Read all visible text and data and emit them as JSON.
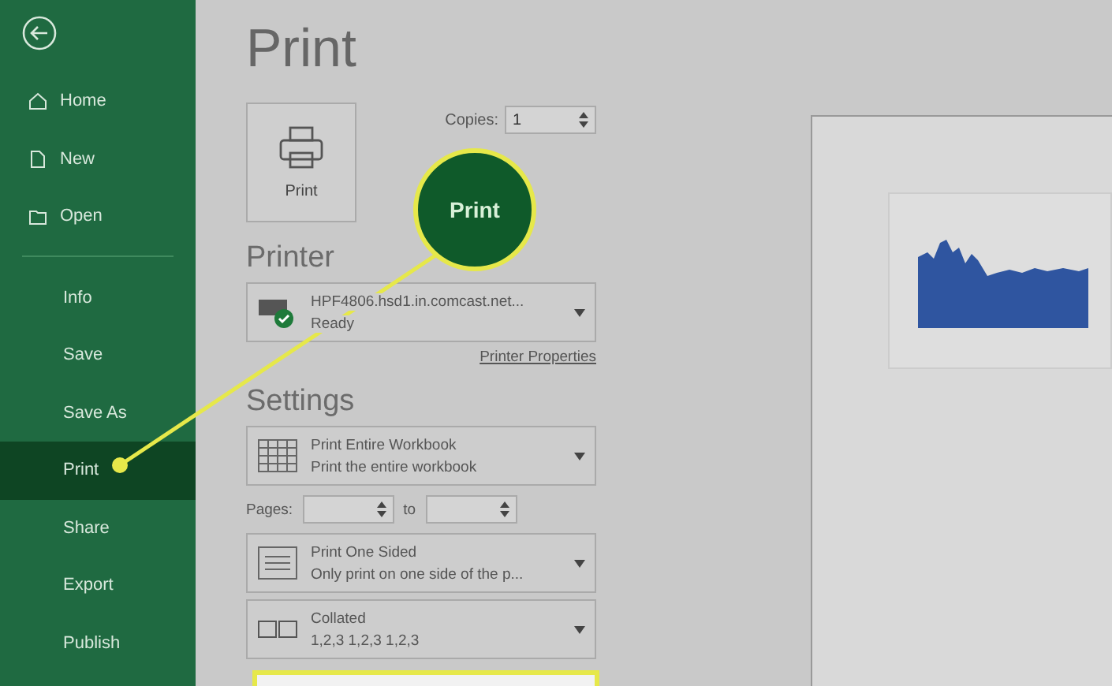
{
  "sidebar": {
    "items": [
      {
        "label": "Home",
        "kind": "icon",
        "selected": false
      },
      {
        "label": "New",
        "kind": "icon",
        "selected": false
      },
      {
        "label": "Open",
        "kind": "icon",
        "selected": false
      },
      {
        "label": "Info",
        "kind": "plain",
        "selected": false
      },
      {
        "label": "Save",
        "kind": "plain",
        "selected": false
      },
      {
        "label": "Save As",
        "kind": "plain",
        "selected": false
      },
      {
        "label": "Print",
        "kind": "plain",
        "selected": true
      },
      {
        "label": "Share",
        "kind": "plain",
        "selected": false
      },
      {
        "label": "Export",
        "kind": "plain",
        "selected": false
      },
      {
        "label": "Publish",
        "kind": "plain",
        "selected": false
      }
    ]
  },
  "title": "Print",
  "print_button": {
    "label": "Print"
  },
  "copies": {
    "label": "Copies:",
    "value": "1"
  },
  "callout": {
    "label": "Print"
  },
  "printer": {
    "heading": "Printer",
    "name": "HPF4806.hsd1.in.comcast.net...",
    "status": "Ready",
    "properties_link": "Printer Properties"
  },
  "settings": {
    "heading": "Settings",
    "pages_label": "Pages:",
    "to_label": "to",
    "options": [
      {
        "kind": "grid",
        "title": "Print Entire Workbook",
        "subtitle": "Print the entire workbook"
      },
      {
        "kind": "page",
        "title": "Print One Sided",
        "subtitle": "Only print on one side of the p..."
      },
      {
        "kind": "collate",
        "title": "Collated",
        "subtitle": "1,2,3    1,2,3    1,2,3"
      }
    ]
  }
}
